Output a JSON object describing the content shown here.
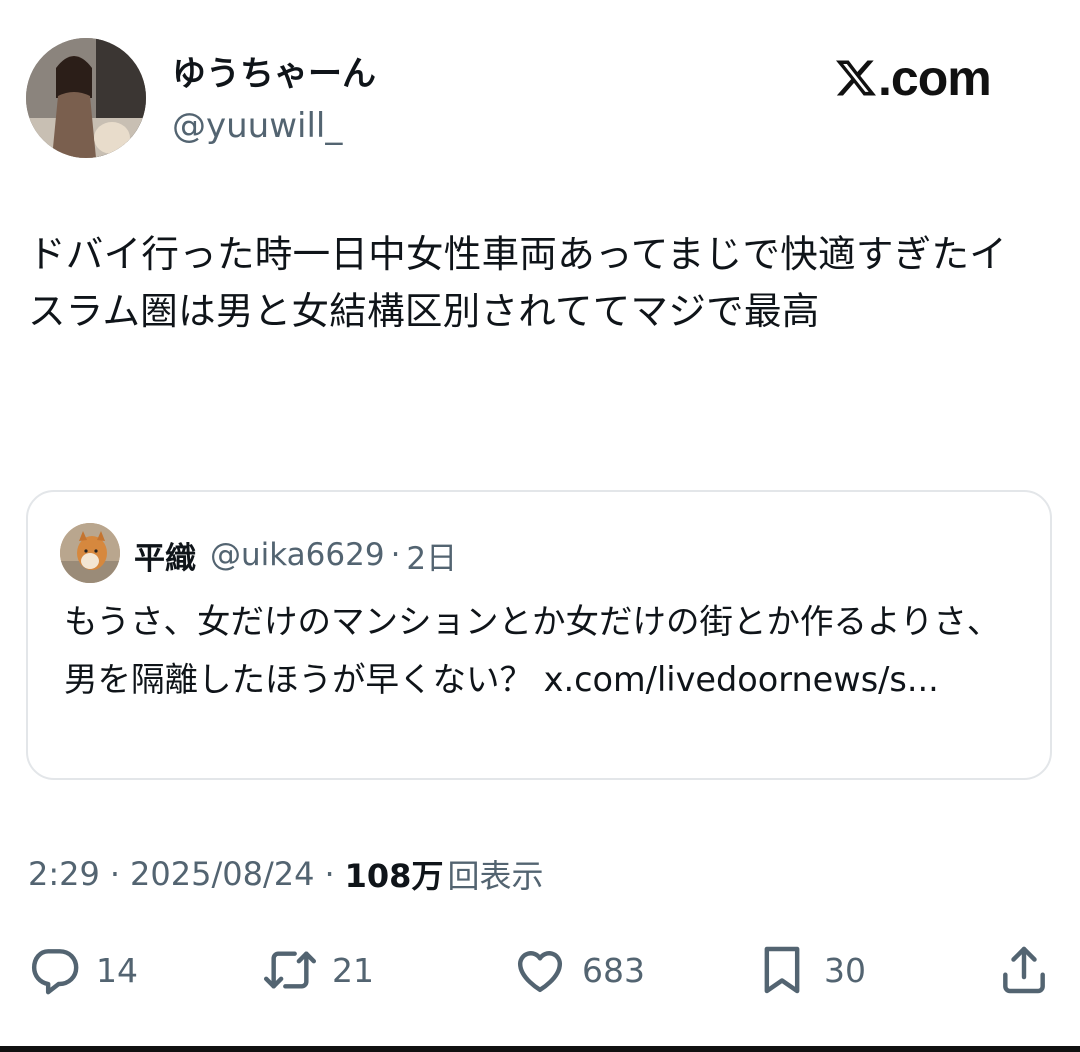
{
  "post": {
    "author": {
      "display_name": "ゆうちゃーん",
      "handle": "@yuuwill_"
    },
    "text": "ドバイ行った時一日中女性車両あってまじで快適すぎたイスラム圏は男と女結構区別されててマジで最高",
    "timestamp": "2:29",
    "separator": "·",
    "date": "2025/08/24",
    "views_count": "108万",
    "views_label": "回表示"
  },
  "brand": {
    "logo_text": ".com",
    "logo_icon": "x-logo-icon"
  },
  "quoted_post": {
    "display_name": "平織",
    "handle": "@uika6629",
    "separator": "·",
    "time": "2日",
    "text": "もうさ、女だけのマンションとか女だけの街とか作るよりさ、男を隔離したほうが早くない？ x.com/livedoornews/s..."
  },
  "actions": {
    "reply": {
      "icon": "reply-icon",
      "count": "14"
    },
    "repost": {
      "icon": "repost-icon",
      "count": "21"
    },
    "like": {
      "icon": "heart-icon",
      "count": "683"
    },
    "bookmark": {
      "icon": "bookmark-icon",
      "count": "30"
    },
    "share": {
      "icon": "share-icon"
    }
  },
  "colors": {
    "text_primary": "#0f1419",
    "text_secondary": "#536471",
    "card_border": "#e3e6e9",
    "background": "#ffffff"
  }
}
